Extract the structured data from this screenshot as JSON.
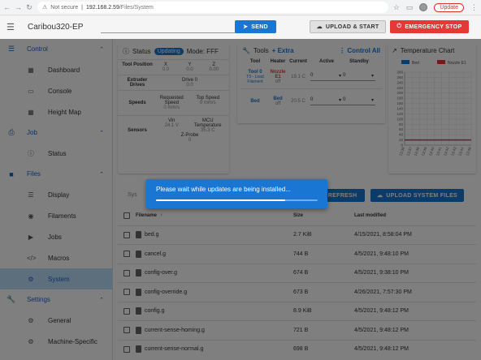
{
  "browser": {
    "warning": "Not secure",
    "host": "192.168.2.59",
    "path": "/Files/System",
    "update_label": "Update"
  },
  "app": {
    "title": "Caribou320-EP",
    "send_label": "SEND",
    "upload_start_label": "UPLOAD & START",
    "emergency_label": "EMERGENCY STOP"
  },
  "sidebar": {
    "control": "Control",
    "dashboard": "Dashboard",
    "console": "Console",
    "heightmap": "Height Map",
    "job": "Job",
    "jobstatus": "Status",
    "files": "Files",
    "display": "Display",
    "filaments": "Filaments",
    "jobs": "Jobs",
    "macros": "Macros",
    "system": "System",
    "settings": "Settings",
    "general": "General",
    "machine": "Machine-Specific"
  },
  "status": {
    "title": "Status",
    "chip": "Updating",
    "mode": "Mode: FFF",
    "tool_position": "Tool Position",
    "x": "X",
    "y": "Y",
    "z": "Z",
    "xv": "0.0",
    "yv": "0.0",
    "zv": "0.00",
    "extruder_drives": "Extruder Drives",
    "drive0": "Drive 0",
    "drive0v": "0.0",
    "speeds": "Speeds",
    "requested_speed": "Requested Speed",
    "requested_speed_v": "0 mm/s",
    "top_speed": "Top Speed",
    "top_speed_v": "0 mm/s",
    "sensors": "Sensors",
    "vin": "Vin",
    "vin_v": "24.1 V",
    "mcu_temp": "MCU Temperature",
    "mcu_temp_v": "35.3 C",
    "zprobe": "Z-Probe",
    "zprobe_v": "0"
  },
  "tools": {
    "title": "Tools",
    "extra": "Extra",
    "control_all": "Control All",
    "h_tool": "Tool",
    "h_heater": "Heater",
    "h_current": "Current",
    "h_active": "Active",
    "h_standby": "Standby",
    "tool0": "Tool 0",
    "t0load": "T0 - Load Filament",
    "heater_nozzle": "Nozzle",
    "heater_e1": "E1",
    "heater_state": "off",
    "current0": "19.1 C",
    "active0": "0",
    "standby0": "0",
    "bed": "Bed",
    "bed_heater": "Bed",
    "bed_state": "off",
    "current_bed": "20.5 C",
    "active_bed": "0",
    "standby_bed": "0"
  },
  "tempchart": {
    "title": "Temperature Chart"
  },
  "chart_data": {
    "type": "line",
    "title": "Temperature Chart",
    "series": [
      {
        "name": "Bed",
        "color": "#1976d2",
        "values": [
          20.5,
          20.5,
          20.5,
          20.5,
          20.5,
          20.5,
          20.5,
          20.5,
          20.5,
          20.5
        ]
      },
      {
        "name": "Nozzle E1",
        "color": "#e53935",
        "values": [
          19.1,
          19.1,
          19.1,
          19.1,
          19.1,
          19.1,
          19.1,
          19.1,
          19.1,
          19.1
        ]
      }
    ],
    "x": [
      "13:36",
      "13:37",
      "13:38",
      "13:39",
      "13:40",
      "13:41",
      "13:42",
      "13:43",
      "13:44",
      "13:46"
    ],
    "ylim": [
      0,
      280
    ],
    "yticks": [
      0,
      20,
      40,
      60,
      80,
      100,
      120,
      140,
      160,
      180,
      200,
      220,
      240,
      260,
      280
    ]
  },
  "sysbar": {
    "sys_text": "Sys",
    "refresh_label": "REFRESH",
    "upload_label": "UPLOAD SYSTEM FILES"
  },
  "files": {
    "h_filename": "Filename",
    "h_size": "Size",
    "h_modified": "Last modified",
    "rows": [
      {
        "name": "bed.g",
        "size": "2.7 KiB",
        "date": "4/15/2021, 8:58:04 PM"
      },
      {
        "name": "cancel.g",
        "size": "744 B",
        "date": "4/5/2021, 9:48:10 PM"
      },
      {
        "name": "config-over.g",
        "size": "674 B",
        "date": "4/5/2021, 9:38:10 PM"
      },
      {
        "name": "config-override.g",
        "size": "673 B",
        "date": "4/26/2021, 7:57:30 PM"
      },
      {
        "name": "config.g",
        "size": "8.9 KiB",
        "date": "4/5/2021, 9:48:12 PM"
      },
      {
        "name": "current-sense-homing.g",
        "size": "721 B",
        "date": "4/5/2021, 9:48:12 PM"
      },
      {
        "name": "current-sense-normal.g",
        "size": "698 B",
        "date": "4/5/2021, 9:48:12 PM"
      }
    ]
  },
  "dialog": {
    "message": "Please wait while updates are being installed...",
    "progress": 0.8
  }
}
